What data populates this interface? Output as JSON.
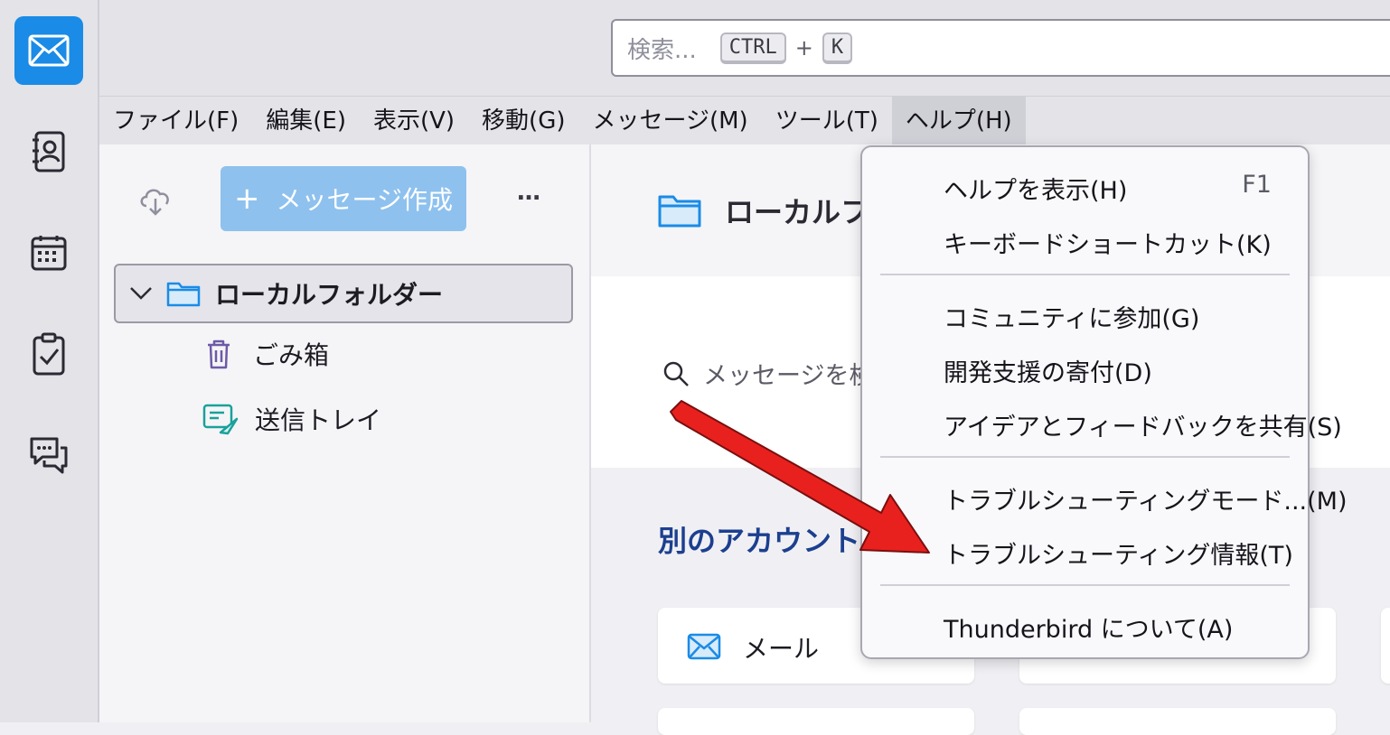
{
  "search": {
    "placeholder": "検索...",
    "key1": "CTRL",
    "plus": "+",
    "key2": "K"
  },
  "menubar": [
    {
      "label": "ファイル(F)"
    },
    {
      "label": "編集(E)"
    },
    {
      "label": "表示(V)"
    },
    {
      "label": "移動(G)"
    },
    {
      "label": "メッセージ(M)"
    },
    {
      "label": "ツール(T)"
    },
    {
      "label": "ヘルプ(H)"
    }
  ],
  "folderpane": {
    "compose_label": "メッセージ作成",
    "compose_plus": "+",
    "more": "…",
    "account": "ローカルフォルダー",
    "folders": [
      {
        "label": "ごみ箱"
      },
      {
        "label": "送信トレイ"
      }
    ]
  },
  "main": {
    "title": "ローカルフォ",
    "search_placeholder": "メッセージを検索",
    "setup_heading": "別のアカウントを",
    "card_mail": "メール"
  },
  "help_menu": {
    "items": [
      {
        "label": "ヘルプを表示(H)",
        "shortcut": "F1"
      },
      {
        "label": "キーボードショートカット(K)"
      },
      {
        "label": "コミュニティに参加(G)"
      },
      {
        "label": "開発支援の寄付(D)"
      },
      {
        "label": "アイデアとフィードバックを共有(S)"
      },
      {
        "label": "トラブルシューティングモード...(M)"
      },
      {
        "label": "トラブルシューティング情報(T)"
      },
      {
        "label": "Thunderbird について(A)"
      }
    ]
  },
  "colors": {
    "accent": "#1a8be6",
    "compose": "#8ec1ee",
    "arrow": "#e8211f",
    "heading": "#1c3f8f"
  }
}
